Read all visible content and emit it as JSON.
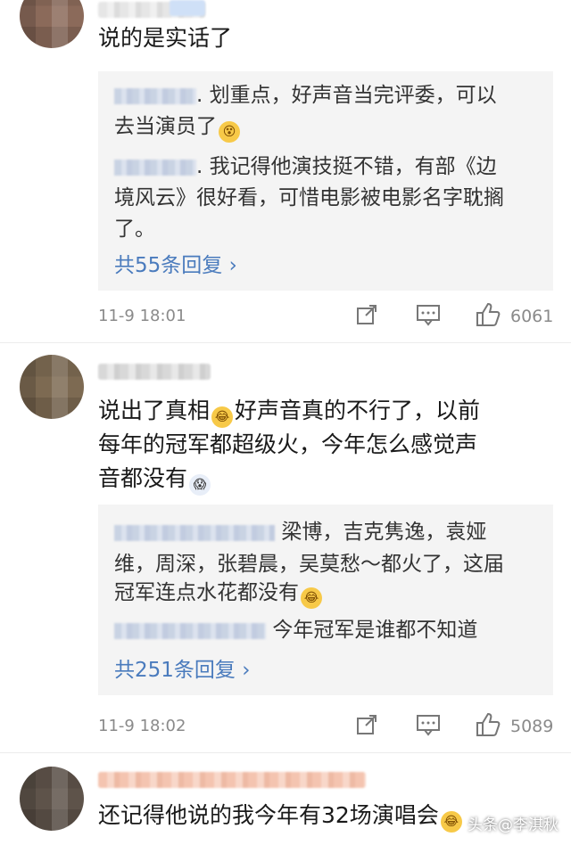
{
  "comments": [
    {
      "text": "说的是实话了",
      "replies": [
        {
          "text_line1": ". 划重点，好声音当完评委，可以",
          "text_line2": "去当演员了"
        },
        {
          "text_line1": ". 我记得他演技挺不错，有部《边",
          "text_line2": "境风云》很好看，可惜电影被电影名字耽搁",
          "text_line3": "了。"
        }
      ],
      "more_replies": "共55条回复 ›",
      "time": "11-9 18:01",
      "likes": "6061"
    },
    {
      "text_line1": "说出了真相",
      "text_line1b": "好声音真的不行了，以前",
      "text_line2": "每年的冠军都超级火，今年怎么感觉声",
      "text_line3": "音都没有",
      "replies": [
        {
          "text_line1": "梁博，吉克隽逸，袁娅",
          "text_line2": "维，周深，张碧晨，吴莫愁～都火了，这届",
          "text_line3": "冠军连点水花都没有"
        },
        {
          "text_line1": "今年冠军是谁都不知道"
        }
      ],
      "more_replies": "共251条回复 ›",
      "time": "11-9 18:02",
      "likes": "5089"
    },
    {
      "text": "还记得他说的我今年有32场演唱会"
    }
  ],
  "watermark": "头条@李淇秋",
  "icons": [
    "share-icon",
    "comment-icon",
    "like-icon"
  ]
}
